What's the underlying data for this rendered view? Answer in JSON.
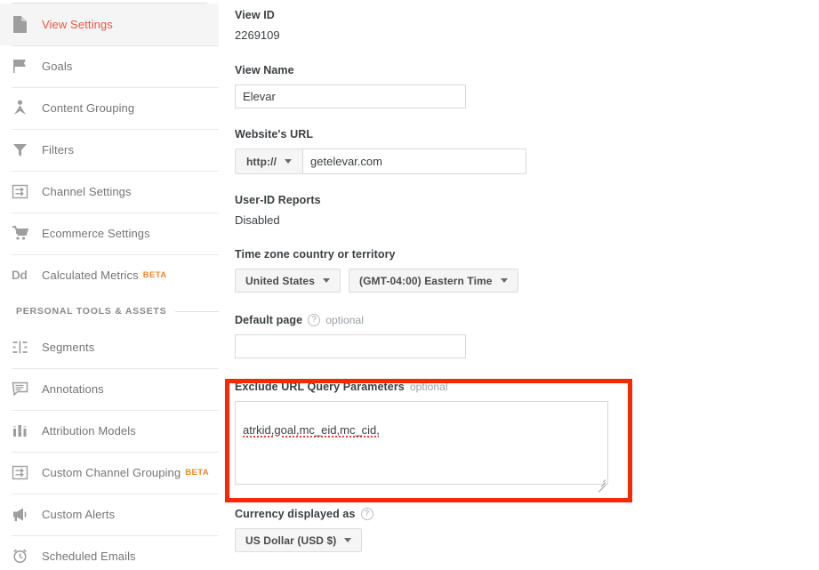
{
  "sidebar": {
    "items": [
      {
        "label": "View Settings",
        "icon": "document-icon",
        "active": true,
        "beta": null
      },
      {
        "label": "Goals",
        "icon": "flag-icon",
        "active": false,
        "beta": null
      },
      {
        "label": "Content Grouping",
        "icon": "content-grouping-icon",
        "active": false,
        "beta": null
      },
      {
        "label": "Filters",
        "icon": "funnel-icon",
        "active": false,
        "beta": null
      },
      {
        "label": "Channel Settings",
        "icon": "channel-settings-icon",
        "active": false,
        "beta": null
      },
      {
        "label": "Ecommerce Settings",
        "icon": "shopping-cart-icon",
        "active": false,
        "beta": null
      },
      {
        "label": "Calculated Metrics",
        "icon": "dd-icon",
        "active": false,
        "beta": "BETA"
      }
    ],
    "section": {
      "title": "PERSONAL TOOLS & ASSETS",
      "items": [
        {
          "label": "Segments",
          "icon": "segments-icon",
          "active": false,
          "beta": null
        },
        {
          "label": "Annotations",
          "icon": "annotations-icon",
          "active": false,
          "beta": null
        },
        {
          "label": "Attribution Models",
          "icon": "bar-chart-icon",
          "active": false,
          "beta": null
        },
        {
          "label": "Custom Channel Grouping",
          "icon": "channel-settings-icon",
          "active": false,
          "beta": "BETA"
        },
        {
          "label": "Custom Alerts",
          "icon": "megaphone-icon",
          "active": false,
          "beta": null
        },
        {
          "label": "Scheduled Emails",
          "icon": "alarm-clock-icon",
          "active": false,
          "beta": null
        }
      ]
    }
  },
  "main": {
    "view_id": {
      "label": "View ID",
      "value": "2269109"
    },
    "view_name": {
      "label": "View Name",
      "value": "Elevar",
      "placeholder": ""
    },
    "website_url": {
      "label": "Website's URL",
      "protocol": "http://",
      "value": "getelevar.com",
      "placeholder": ""
    },
    "user_id_reports": {
      "label": "User-ID Reports",
      "value": "Disabled"
    },
    "time_zone": {
      "label": "Time zone country or territory",
      "country": "United States",
      "zone": "(GMT-04:00) Eastern Time"
    },
    "default_page": {
      "label": "Default page",
      "optional": "optional",
      "help": "?",
      "value": "",
      "placeholder": ""
    },
    "exclude_params": {
      "label": "Exclude URL Query Parameters",
      "optional": "optional",
      "value": "atrkid,goal,mc_eid,mc_cid,",
      "placeholder": "",
      "highlighted": true,
      "highlight_color": "#fa2800"
    },
    "currency": {
      "label": "Currency displayed as",
      "help": "?",
      "value": "US Dollar (USD $)"
    }
  },
  "colors": {
    "accent": "#e8573f",
    "beta": "#f0872b",
    "highlight": "#fa2800",
    "text": "#3c4043",
    "muted": "#757575"
  }
}
